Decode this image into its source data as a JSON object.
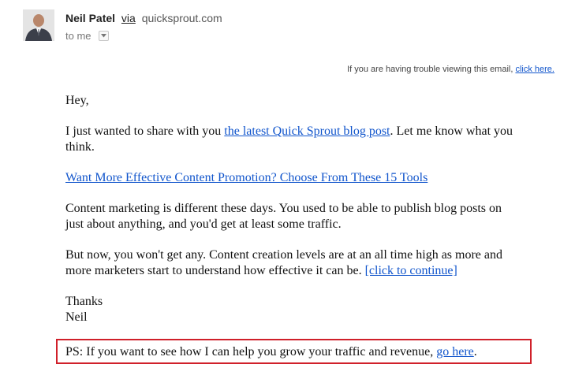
{
  "sender": {
    "name": "Neil Patel",
    "via_label": "via",
    "domain": "quicksprout.com"
  },
  "recipient": {
    "label": "to me"
  },
  "trouble_notice": {
    "text": "If you are having trouble viewing this email, ",
    "link_label": "click here."
  },
  "body": {
    "greeting": "Hey,",
    "intro_before_link": "I just wanted to share with you ",
    "intro_link": "the latest Quick Sprout blog post",
    "intro_after_link": ". Let me know what you think.",
    "article_link": "Want More Effective Content Promotion? Choose From These 15 Tools",
    "para1": "Content marketing is different these days. You used to be able to publish blog posts on just about anything, and you'd get at least some traffic.",
    "para2_text": "But now, you won't get any. Content creation levels are at an all time high as more and more marketers start to understand how effective it can be. ",
    "para2_link": "[click to continue]",
    "signoff": "Thanks",
    "signature": "Neil"
  },
  "ps": {
    "text": "PS: If you want to see how I can help you grow your traffic and revenue, ",
    "link_label": "go here",
    "end": "."
  },
  "colors": {
    "link": "#1155cc",
    "highlight_border": "#d0202a"
  },
  "icons": {
    "avatar": "sender-avatar",
    "toggle": "chevron-down-icon"
  }
}
